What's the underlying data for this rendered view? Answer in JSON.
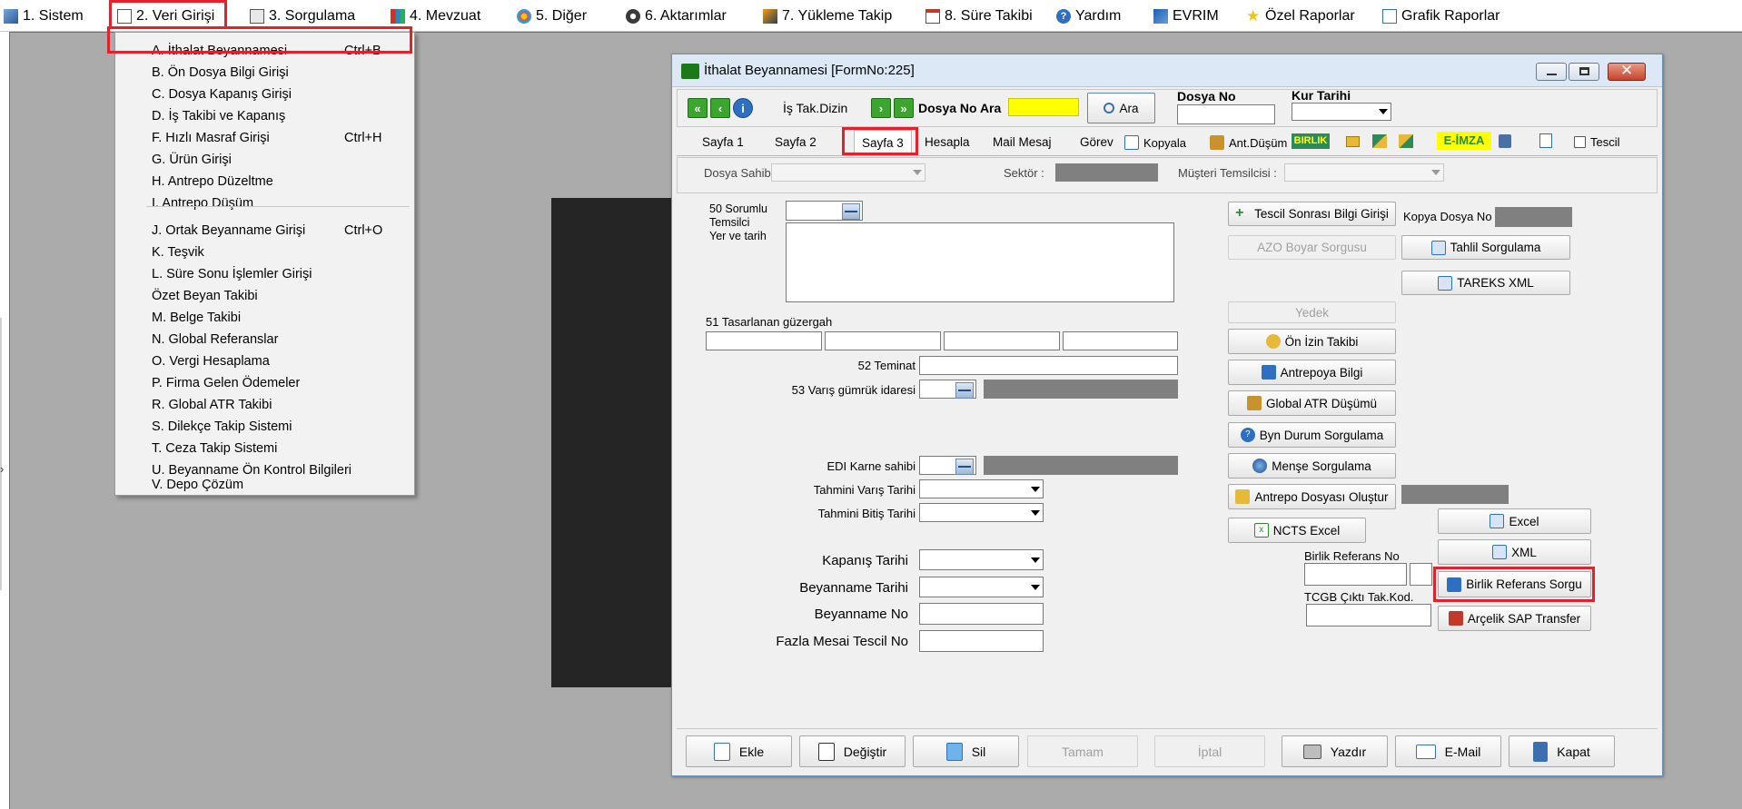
{
  "menubar": {
    "items": [
      {
        "label": "1.  Sistem",
        "icon": "system-icon"
      },
      {
        "label": "2.  Veri Girişi",
        "icon": "data-entry-icon"
      },
      {
        "label": "3.  Sorgulama",
        "icon": "query-icon"
      },
      {
        "label": "4.  Mevzuat",
        "icon": "books-icon"
      },
      {
        "label": "5.  Diğer",
        "icon": "other-icon"
      },
      {
        "label": "6.  Aktarımlar",
        "icon": "transfer-icon"
      },
      {
        "label": "7.  Yükleme Takip",
        "icon": "tracking-icon"
      },
      {
        "label": "8. Süre Takibi",
        "icon": "calendar-icon"
      },
      {
        "label": "Yardım",
        "icon": "help-icon"
      },
      {
        "label": "EVRIM",
        "icon": "evrim-icon"
      },
      {
        "label": "Özel Raporlar",
        "icon": "star-icon"
      },
      {
        "label": "Grafik Raporlar",
        "icon": "chart-icon"
      }
    ]
  },
  "dropdown": {
    "items": [
      {
        "label": "A.   İthalat Beyannamesi",
        "shortcut": "Ctrl+B"
      },
      {
        "label": "B.   Ön Dosya Bilgi Girişi",
        "shortcut": ""
      },
      {
        "label": "C.   Dosya Kapanış Girişi",
        "shortcut": ""
      },
      {
        "label": "D.   İş Takibi ve Kapanış",
        "shortcut": ""
      },
      {
        "label": "F.   Hızlı Masraf Girişi",
        "shortcut": "Ctrl+H"
      },
      {
        "label": "G.   Ürün Girişi",
        "shortcut": ""
      },
      {
        "label": "H.   Antrepo Düzeltme",
        "shortcut": ""
      },
      {
        "label": "I.    Antrepo Düşüm",
        "shortcut": ""
      },
      {
        "label": "J.   Ortak Beyanname Girişi",
        "shortcut": "Ctrl+O"
      },
      {
        "label": "K.   Teşvik",
        "shortcut": ""
      },
      {
        "label": "L.   Süre Sonu İşlemler Girişi",
        "shortcut": ""
      },
      {
        "label": "      Özet Beyan Takibi",
        "shortcut": ""
      },
      {
        "label": "M.   Belge Takibi",
        "shortcut": ""
      },
      {
        "label": "N.  Global Referanslar",
        "shortcut": ""
      },
      {
        "label": "O. Vergi Hesaplama",
        "shortcut": ""
      },
      {
        "label": "P. Firma Gelen Ödemeler",
        "shortcut": ""
      },
      {
        "label": "R. Global ATR Takibi",
        "shortcut": ""
      },
      {
        "label": "S. Dilekçe Takip Sistemi",
        "shortcut": ""
      },
      {
        "label": "T. Ceza Takip Sistemi",
        "shortcut": ""
      },
      {
        "label": "U. Beyanname Ön Kontrol Bilgileri",
        "shortcut": ""
      },
      {
        "label": "V. Depo Çözüm",
        "shortcut": ""
      }
    ]
  },
  "window": {
    "title": "İthalat Beyannamesi [FormNo:225]",
    "toolbar": {
      "is_tak_dizin": "İş Tak.Dizin",
      "dosya_no_ara": "Dosya No Ara",
      "ara_button": "Ara",
      "dosya_no_label": "Dosya No",
      "kur_tarihi_label": "Kur Tarihi"
    },
    "tabs": [
      "Sayfa 1",
      "Sayfa 2",
      "Sayfa 3",
      "Hesapla",
      "Mail Mesaj",
      "Görev"
    ],
    "tab_tools": {
      "kopyala": "Kopyala",
      "ant_dusum": "Ant.Düşüm",
      "birlik": "BIRLIK",
      "e_imza": "E-İMZA",
      "tescil": "Tescil"
    },
    "header_fields": {
      "dosya_sahibi": "Dosya Sahibi :",
      "sektor": "Sektör :",
      "musteri_temsilcisi": "Müşteri Temsilcisi :"
    },
    "form": {
      "sorumlu_temsilci": "50 Sorumlu\nTemsilci\nYer ve tarih",
      "tasarlanan_guzergah": "51 Tasarlanan güzergah",
      "teminat": "52 Teminat",
      "varis_gumruk": "53 Varış gümrük idaresi",
      "edi_karne": "EDI Karne sahibi",
      "tahmini_varis": "Tahmini Varış Tarihi",
      "tahmini_bitis": "Tahmini Bitiş Tarihi",
      "kapanis_tarihi": "Kapanış Tarihi",
      "beyanname_tarihi": "Beyanname Tarihi",
      "beyanname_no": "Beyanname No",
      "fazla_mesai": "Fazla Mesai Tescil No"
    },
    "right_buttons": {
      "tescil_sonrasi": "Tescil Sonrası Bilgi Girişi",
      "azo_boyar": "AZO Boyar Sorgusu",
      "yedek": "Yedek",
      "on_izin": "Ön İzin Takibi",
      "antrepoya_bilgi": "Antrepoya Bilgi",
      "global_atr": "Global ATR Düşümü",
      "byn_durum": "Byn Durum Sorgulama",
      "mense": "Menşe Sorgulama",
      "antrepo_dosyasi": "Antrepo Dosyası Oluştur",
      "ncts_excel": "NCTS Excel",
      "kopya_dosya_no": "Kopya Dosya No",
      "tahlil": "Tahlil Sorgulama",
      "tareks": "TAREKS XML",
      "excel": "Excel",
      "xml": "XML",
      "birlik_ref_no": "Birlik Referans No",
      "birlik_ref_sorgu": "Birlik Referans Sorgu",
      "tcgb": "TCGB Çıktı Tak.Kod.",
      "arcelik": "Arçelik SAP Transfer"
    },
    "bottom_buttons": {
      "ekle": "Ekle",
      "degistir": "Değiştir",
      "sil": "Sil",
      "tamam": "Tamam",
      "iptal": "İptal",
      "yazdir": "Yazdır",
      "email": "E-Mail",
      "kapat": "Kapat"
    }
  },
  "colors": {
    "highlight_box": "#e4202a",
    "search_field": "#ffff00",
    "nav_green": "#3aa62e",
    "birlik_bg": "#2e8b57",
    "eimza_bg": "#ffff00"
  }
}
